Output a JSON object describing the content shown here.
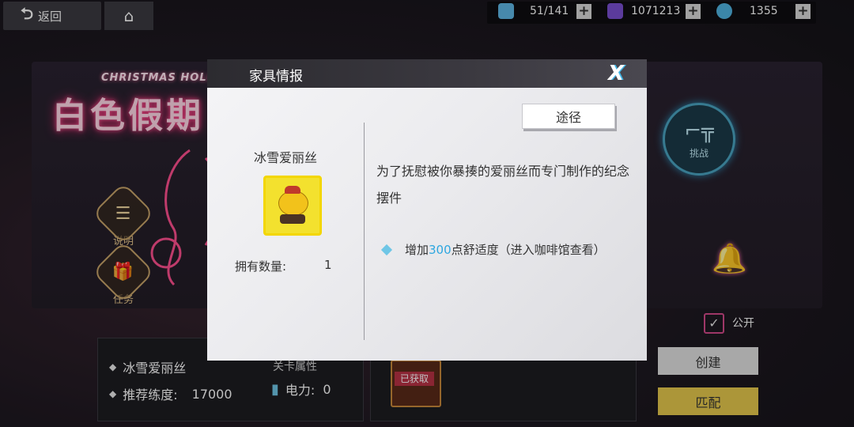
{
  "topbar": {
    "back_label": "返回",
    "resources": [
      {
        "name": "stamina",
        "value": "51/141",
        "color": "#5fb7e6"
      },
      {
        "name": "crystal",
        "value": "1071213",
        "color": "#7a4fd0"
      },
      {
        "name": "diamond",
        "value": "1355",
        "color": "#4fb3e0"
      }
    ],
    "plus_label": "+"
  },
  "banner": {
    "event_title": "白色假期",
    "event_subtitle": "CHRISTMAS HOLIDAY",
    "side_buttons": [
      {
        "label": "说明",
        "icon": "list-icon"
      },
      {
        "label": "任务",
        "icon": "gift-icon"
      }
    ]
  },
  "modal": {
    "title": "家具情报",
    "item_name": "冰雪爱丽丝",
    "owned_label": "拥有数量:",
    "owned_value": "1",
    "route_label": "途径",
    "description": "为了抚慰被你暴揍的爱丽丝而专门制作的纪念摆件",
    "effect_prefix": "增加",
    "effect_value": "300",
    "effect_suffix": "点舒适度（进入咖啡馆查看）"
  },
  "bottom": {
    "item_name": "冰雪爱丽丝",
    "recommend_label": "推荐练度:",
    "recommend_value": "17000",
    "attr_label": "关卡属性",
    "power_label": "电力:",
    "power_value": "0",
    "obtained_label": "已获取"
  },
  "right": {
    "challenge_label": "挑战",
    "public_label": "公开",
    "create_label": "创建",
    "match_label": "匹配"
  }
}
